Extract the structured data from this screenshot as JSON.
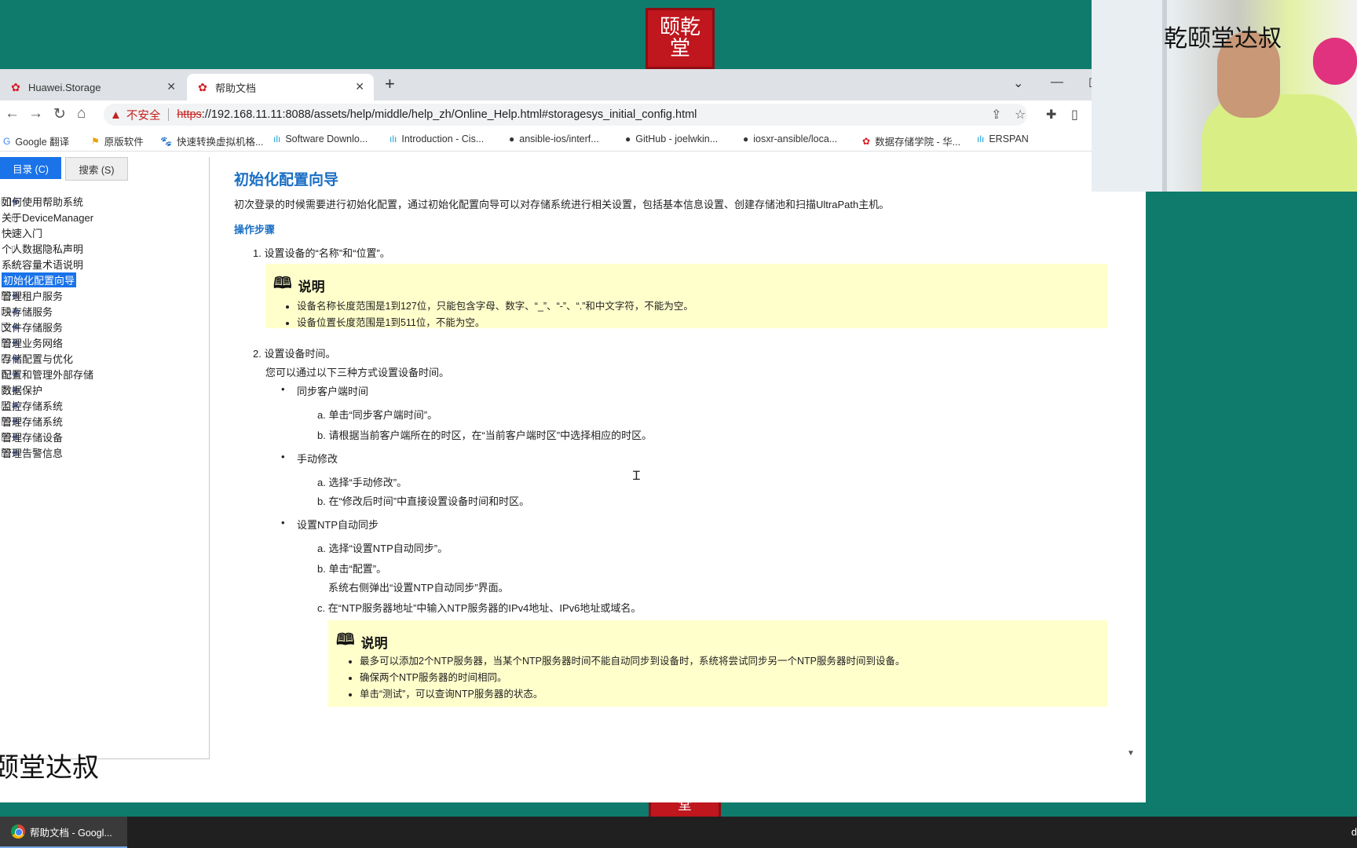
{
  "brand_seal": {
    "text": "颐乾堂"
  },
  "watermark": {
    "left_text": "颐堂达叔",
    "cam_text": "乾颐堂达叔"
  },
  "browser": {
    "tabs": [
      {
        "title": "Huawei.Storage",
        "active": false
      },
      {
        "title": "帮助文档",
        "active": true
      }
    ],
    "address": {
      "warning_label": "不安全",
      "scheme": "https",
      "rest": "://192.168.11.11:8088/assets/help/middle/help_zh/Online_Help.html#storagesys_initial_config.html"
    },
    "bookmarks": [
      "Google 翻译",
      "原版软件",
      "快速转换虚拟机格...",
      "Software Downlo...",
      "Introduction - Cis...",
      "ansible-ios/interf...",
      "GitHub - joelwkin...",
      "iosxr-ansible/loca...",
      "数据存储学院 - 华...",
      "ERSPAN"
    ]
  },
  "help": {
    "left_tabs": [
      "目录 (C)",
      "搜索 (S)"
    ],
    "tree": [
      {
        "label": "如何使用帮助系统",
        "type": "folder"
      },
      {
        "label": "关于DeviceManager",
        "type": "page"
      },
      {
        "label": "快速入门",
        "type": "page"
      },
      {
        "label": "个人数据隐私声明",
        "type": "page"
      },
      {
        "label": "系统容量术语说明",
        "type": "page"
      },
      {
        "label": "初始化配置向导",
        "type": "page",
        "selected": true
      },
      {
        "label": "管理租户服务",
        "type": "folder"
      },
      {
        "label": "块存储服务",
        "type": "folder"
      },
      {
        "label": "文件存储服务",
        "type": "folder"
      },
      {
        "label": "管理业务网络",
        "type": "folder"
      },
      {
        "label": "存储配置与优化",
        "type": "folder"
      },
      {
        "label": "配置和管理外部存储",
        "type": "folder"
      },
      {
        "label": "数据保护",
        "type": "folder"
      },
      {
        "label": "监控存储系统",
        "type": "folder"
      },
      {
        "label": "管理存储系统",
        "type": "folder"
      },
      {
        "label": "管理存储设备",
        "type": "folder"
      },
      {
        "label": "管理告警信息",
        "type": "folder"
      }
    ],
    "title": "初始化配置向导",
    "intro": "初次登录的时候需要进行初始化配置，通过初始化配置向导可以对存储系统进行相关设置，包括基本信息设置、创建存储池和扫描UltraPath主机。",
    "steps_heading": "操作步骤",
    "step1": "1. 设置设备的“名称”和“位置”。",
    "note1": {
      "title": "说明",
      "items": [
        "设备名称长度范围是1到127位，只能包含字母、数字、“_”、“-”、“.”和中文字符，不能为空。",
        "设备位置长度范围是1到511位，不能为空。"
      ]
    },
    "step2": "2. 设置设备时间。",
    "step2_desc": "您可以通过以下三种方式设置设备时间。",
    "sync_client": "同步客户端时间",
    "sync_a": "a. 单击“同步客户端时间”。",
    "sync_b": "b. 请根据当前客户端所在的时区，在“当前客户端时区”中选择相应的时区。",
    "manual": "手动修改",
    "manual_a": "a. 选择“手动修改”。",
    "manual_b": "b. 在“修改后时间”中直接设置设备时间和时区。",
    "ntp": "设置NTP自动同步",
    "ntp_a": "a. 选择“设置NTP自动同步”。",
    "ntp_b": "b. 单击“配置”。",
    "ntp_b_desc": "系统右侧弹出“设置NTP自动同步”界面。",
    "ntp_c": "c. 在“NTP服务器地址”中输入NTP服务器的IPv4地址、IPv6地址或域名。",
    "note2": {
      "title": "说明",
      "items": [
        "最多可以添加2个NTP服务器，当某个NTP服务器时间不能自动同步到设备时，系统将尝试同步另一个NTP服务器时间到设备。",
        "确保两个NTP服务器的时间相同。",
        "单击“测试”，可以查询NTP服务器的状态。"
      ]
    }
  },
  "taskbar": {
    "task_label": "帮助文档 - Googl...",
    "edge_text": "d"
  }
}
